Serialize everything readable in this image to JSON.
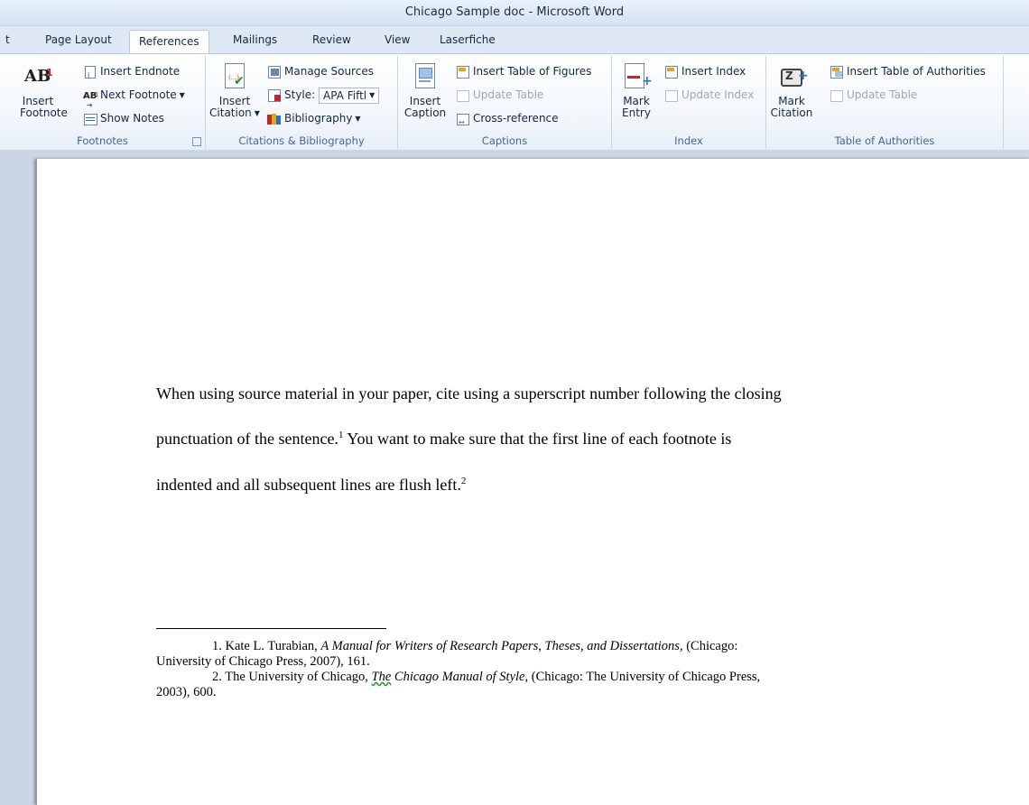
{
  "window": {
    "title": "Chicago Sample doc  -  Microsoft Word"
  },
  "tabs": {
    "partial": "t",
    "page_layout": "Page Layout",
    "references": "References",
    "mailings": "Mailings",
    "review": "Review",
    "view": "View",
    "laserfiche": "Laserfiche"
  },
  "ribbon": {
    "footnotes": {
      "label": "Footnotes",
      "insert_footnote_line1": "Insert",
      "insert_footnote_line2": "Footnote",
      "insert_endnote": "Insert Endnote",
      "next_footnote": "Next Footnote",
      "show_notes": "Show Notes"
    },
    "citations": {
      "label": "Citations & Bibliography",
      "insert_citation_line1": "Insert",
      "insert_citation_line2": "Citation",
      "manage_sources": "Manage Sources",
      "style_label": "Style:",
      "style_value": "APA Fiftl",
      "bibliography": "Bibliography"
    },
    "captions": {
      "label": "Captions",
      "insert_caption_line1": "Insert",
      "insert_caption_line2": "Caption",
      "insert_table_of_figures": "Insert Table of Figures",
      "update_table": "Update Table",
      "cross_reference": "Cross-reference"
    },
    "index": {
      "label": "Index",
      "mark_entry_line1": "Mark",
      "mark_entry_line2": "Entry",
      "insert_index": "Insert Index",
      "update_index": "Update Index"
    },
    "authorities": {
      "label": "Table of Authorities",
      "mark_citation_line1": "Mark",
      "mark_citation_line2": "Citation",
      "insert_table_of_authorities": "Insert Table of Authorities",
      "update_table": "Update Table"
    }
  },
  "document": {
    "line1": "When using source material in your paper, cite using a superscript number following the closing",
    "line2_pre": "punctuation of the sentence.",
    "line2_sup": "1",
    "line2_post": " You want to make sure that the first line of each footnote is",
    "line3_pre": "indented and all subsequent lines are flush left.",
    "line3_sup": "2",
    "footnotes": {
      "fn1_num": "1. Kate L. Turabian, ",
      "fn1_title": "A Manual for Writers of Research Papers, Theses, and Dissertations",
      "fn1_rest": ", (Chicago:",
      "fn1_line2": "University of Chicago Press, 2007), 161.",
      "fn2_num": "2. The University of Chicago, ",
      "fn2_title_the": "The",
      "fn2_title_rest": " Chicago Manual of Style",
      "fn2_rest": ", (Chicago: The University of Chicago Press,",
      "fn2_line2": "2003), 600."
    }
  },
  "colors": {
    "ribbon_text": "#15283f",
    "group_label": "#4d6586",
    "disabled": "#9aa8b8",
    "footnote_red": "#c0272d"
  }
}
